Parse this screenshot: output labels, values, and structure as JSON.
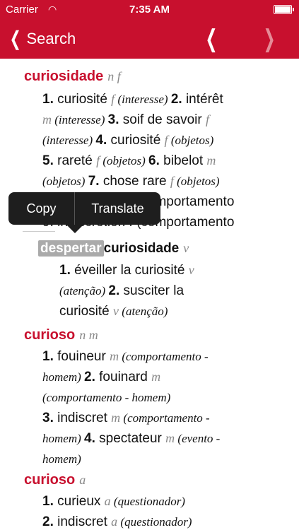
{
  "status": {
    "carrier": "Carrier",
    "time": "7:35 AM"
  },
  "nav": {
    "back_label": "Search"
  },
  "popup": {
    "copy": "Copy",
    "translate": "Translate"
  },
  "e1": {
    "hw": "curiosidade",
    "pos": "n f",
    "l1": {
      "n1": "1.",
      "t1": " curiosité ",
      "g1": "f",
      "c1": " (interesse) ",
      "n2": "2.",
      "t2": " intérêt"
    },
    "l2": {
      "g1": "m",
      "c1": " (interesse) ",
      "n3": "3.",
      "t3": " soif de savoir ",
      "g2": "f"
    },
    "l3": {
      "c1": "(interesse) ",
      "n4": "4.",
      "t4": " curiosité ",
      "g1": "f",
      "c2": " (objetos)"
    },
    "l4": {
      "n5": "5.",
      "t5": " rareté ",
      "g1": "f",
      "c1": " (objetos) ",
      "n6": "6.",
      "t6": " bibelot ",
      "g2": "m"
    },
    "l5": {
      "c1": "(objetos) ",
      "n7": "7.",
      "t7": " chose rare ",
      "g1": "f",
      "c2": " (objetos)"
    },
    "l6": {
      "t": "8. indiscrétion f (comportamento"
    },
    "l7": {
      "t": "9. indiscrétion f (comportamento"
    }
  },
  "e2": {
    "hl": "despertar",
    "hw": "curiosidade",
    "pos": "v",
    "l1": {
      "n1": "1.",
      "t1": " éveiller la curiosité ",
      "g1": "v"
    },
    "l2": {
      "c1": "(atenção) ",
      "n2": "2.",
      "t2": " susciter la"
    },
    "l3": {
      "t": "curiosité ",
      "g1": "v",
      "c1": " (atenção)"
    }
  },
  "e3": {
    "hw": "curioso",
    "pos": "n m",
    "l1": {
      "n1": "1.",
      "t1": " fouineur ",
      "g1": "m",
      "c1": " (comportamento -"
    },
    "l2": {
      "c1": "homem) ",
      "n2": "2.",
      "t2": " fouinard ",
      "g1": "m"
    },
    "l3": {
      "c1": "(comportamento - homem)"
    },
    "l4": {
      "n3": "3.",
      "t3": " indiscret ",
      "g1": "m",
      "c1": " (comportamento -"
    },
    "l5": {
      "c1": "homem) ",
      "n4": "4.",
      "t4": " spectateur ",
      "g1": "m",
      "c2": " (evento -"
    },
    "l6": {
      "c1": "homem)"
    }
  },
  "e4": {
    "hw": "curioso",
    "pos": "a",
    "l1": {
      "n1": "1.",
      "t1": " curieux ",
      "g1": "a",
      "c1": " (questionador)"
    },
    "l2": {
      "n2": "2.",
      "t2": " indiscret ",
      "g1": "a",
      "c1": " (questionador)"
    }
  }
}
